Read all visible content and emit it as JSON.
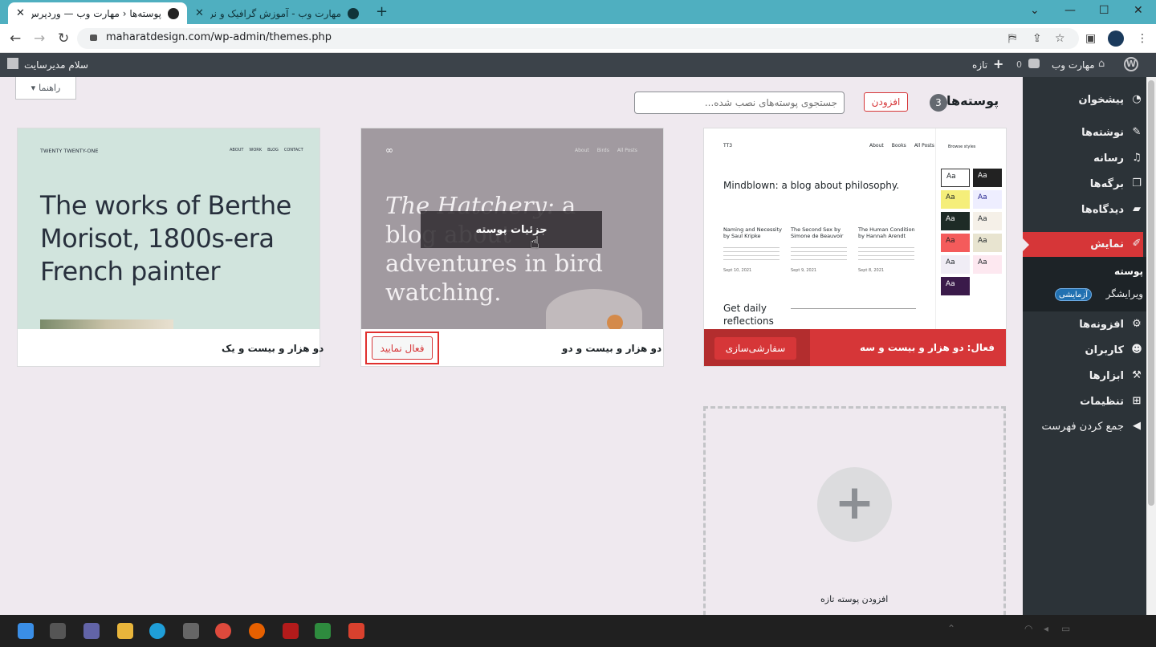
{
  "browser": {
    "tabs": [
      {
        "title": "پوسته‌ها ‹ مهارت وب — وردپرس"
      },
      {
        "title": "مهارت وب - آموزش گرافیک و نرم افزار"
      }
    ],
    "new_tab": "+",
    "url": "maharatdesign.com/wp-admin/themes.php"
  },
  "adminbar": {
    "site_name": "مهارت وب",
    "comments_count": "0",
    "new_label": "تازه",
    "greeting": "سلام مدیرسایت"
  },
  "menu": {
    "items": [
      {
        "label": "پیشخوان"
      },
      {
        "label": "نوشته‌ها"
      },
      {
        "label": "رسانه"
      },
      {
        "label": "برگه‌ها"
      },
      {
        "label": "دیدگاه‌ها"
      },
      {
        "label": "نمایش"
      },
      {
        "label": "افزونه‌ها"
      },
      {
        "label": "کاربران"
      },
      {
        "label": "ابزارها"
      },
      {
        "label": "تنظیمات"
      },
      {
        "label": "جمع کردن فهرست"
      }
    ],
    "submenu": {
      "themes": "پوسته",
      "editor": "ویرایشگر",
      "editor_badge": "آزمایشی"
    }
  },
  "page": {
    "help_tab": "راهنما",
    "title": "پوسته‌ها",
    "count": "3",
    "add_button": "افزودن",
    "search_placeholder": "جستجوی پوسته‌های نصب شده..."
  },
  "themes": [
    {
      "name": "دو هزار و بیست و سه",
      "active_prefix": "فعال:",
      "customize_label": "سفارشی‌سازی",
      "preview": {
        "logo": "TT3",
        "nav": [
          "About",
          "Books",
          "All Posts"
        ],
        "heading": "Mindblown: a blog about philosophy.",
        "posts": [
          {
            "title": "Naming and Necessity by Saul Kripke",
            "date": "Sept 10, 2021"
          },
          {
            "title": "The Second Sex by Simone de Beauvoir",
            "date": "Sept 9, 2021"
          },
          {
            "title": "The Human Condition by Hannah Arendt",
            "date": "Sept 8, 2021"
          }
        ],
        "footer_text": "Get daily reflections",
        "styles_title": "Browse styles",
        "swatch_text": "Aa"
      }
    },
    {
      "name": "دو هزار و بیست و دو",
      "activate_label": "فعال نمایید",
      "details_label": "جزئیات پوسته",
      "preview": {
        "nav": [
          "About",
          "Birds",
          "All Posts"
        ],
        "heading_italic": "The Hatchery:",
        "heading_rest": " a blog about adventures in bird watching."
      }
    },
    {
      "name": "دو هزار و بیست و یک",
      "preview": {
        "site_title": "TWENTY TWENTY-ONE",
        "nav": [
          "ABOUT",
          "WORK",
          "BLOG",
          "CONTACT"
        ],
        "heading": "The works of Berthe Morisot, 1800s-era French painter"
      }
    }
  ],
  "add_new_theme": {
    "label": "افزودن پوسته تازه",
    "plus": "+"
  },
  "colors": {
    "accent_red": "#d63638",
    "admin_dark": "#2c3338",
    "tab_strip": "#4fafc0"
  }
}
